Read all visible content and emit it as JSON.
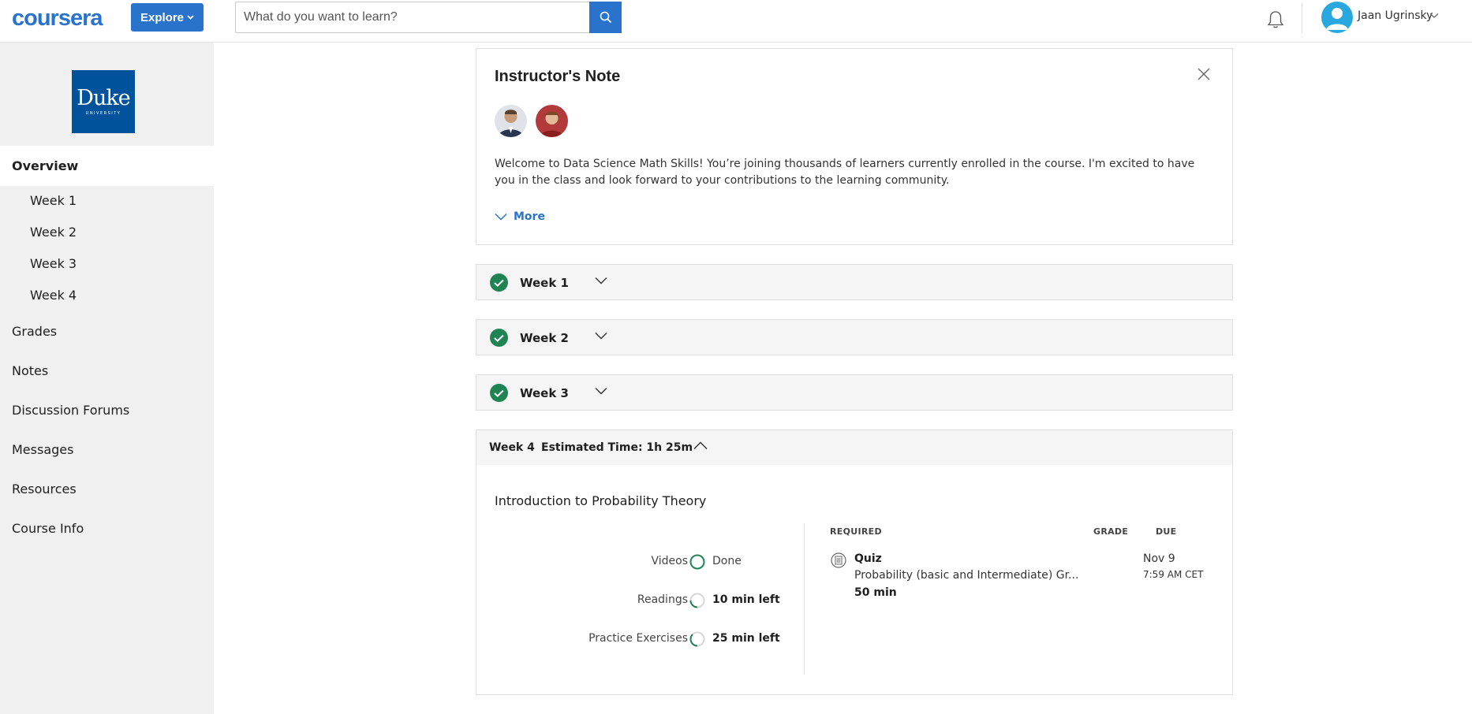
{
  "header": {
    "logo_text": "coursera",
    "explore_label": "Explore",
    "search_placeholder": "What do you want to learn?",
    "user_name": "Jaan Ugrinsky",
    "accent_color": "#2a73cc"
  },
  "sidebar": {
    "university_logo": {
      "main": "Duke",
      "sub": "UNIVERSITY"
    },
    "overview_label": "Overview",
    "weeks": [
      "Week 1",
      "Week 2",
      "Week 3",
      "Week 4"
    ],
    "items": [
      "Grades",
      "Notes",
      "Discussion Forums",
      "Messages",
      "Resources",
      "Course Info"
    ]
  },
  "note": {
    "title": "Instructor's Note",
    "text": "Welcome to Data Science Math Skills! You’re joining thousands of learners currently enrolled in the course. I'm excited to have you in the class and look forward to your contributions to the learning community.",
    "more_label": "More"
  },
  "weeks": [
    {
      "label": "Week 1",
      "completed": true
    },
    {
      "label": "Week 2",
      "completed": true
    },
    {
      "label": "Week 3",
      "completed": true
    }
  ],
  "week4": {
    "label": "Week 4",
    "estimated_time": "Estimated Time: 1h 25m",
    "module_title": "Introduction to Probability Theory",
    "progress": [
      {
        "label": "Videos",
        "status": "Done",
        "fraction": 1.0
      },
      {
        "label": "Readings",
        "status": "10 min left",
        "fraction": 0.25
      },
      {
        "label": "Practice Exercises",
        "status": "25 min left",
        "fraction": 0.45
      }
    ],
    "table": {
      "col_required": "REQUIRED",
      "col_grade": "GRADE",
      "col_due": "DUE",
      "item": {
        "type": "Quiz",
        "name": "Probability (basic and Intermediate) Gr...",
        "duration": "50 min",
        "due_date": "Nov 9",
        "due_time": "7:59 AM CET"
      }
    }
  }
}
